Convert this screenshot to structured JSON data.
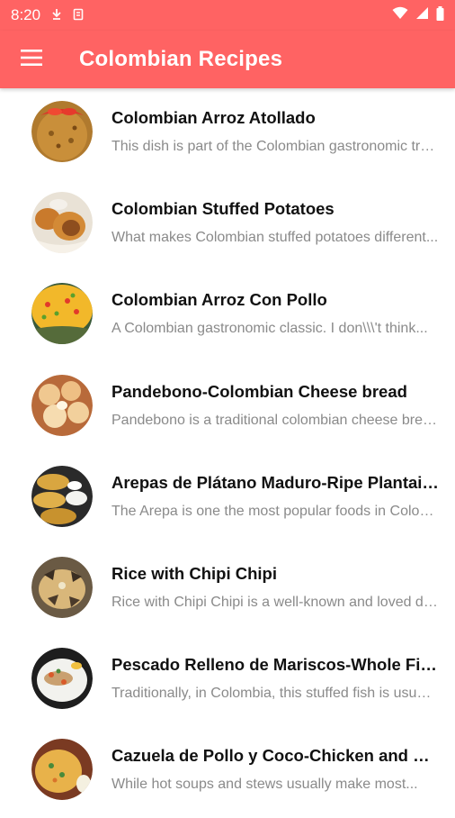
{
  "status_bar": {
    "time": "8:20",
    "icons": [
      "download-status-icon",
      "storage-status-icon",
      "wifi-icon",
      "signal-icon",
      "battery-icon"
    ]
  },
  "app_bar": {
    "title": "Colombian Recipes",
    "background": "#ff6363",
    "menu_icon": "hamburger-menu-icon"
  },
  "recipes": [
    {
      "title": "Colombian Arroz Atollado",
      "description": "This dish is part of the Colombian gastronomic traditions...",
      "thumbnail": "rice-dish-thumbnail"
    },
    {
      "title": "Colombian Stuffed Potatoes",
      "description": "What makes Colombian stuffed potatoes different...",
      "thumbnail": "stuffed-potatoes-thumbnail"
    },
    {
      "title": "Colombian Arroz Con Pollo",
      "description": "A Colombian gastronomic classic. I don\\\\\\'t think...",
      "thumbnail": "chicken-rice-thumbnail"
    },
    {
      "title": "Pandebono-Colombian Cheese bread",
      "description": "Pandebono is a traditional colombian cheese bread...",
      "thumbnail": "cheese-bread-thumbnail"
    },
    {
      "title": "Arepas de Plátano Maduro-Ripe Plantain Arepas",
      "description": "The Arepa is one the most popular foods in Colombia...",
      "thumbnail": "arepas-thumbnail"
    },
    {
      "title": "Rice with Chipi Chipi",
      "description": "Rice with Chipi Chipi is a well-known and loved dish...",
      "thumbnail": "chipi-chipi-thumbnail"
    },
    {
      "title": "Pescado Relleno de Mariscos-Whole Fish Stuffed",
      "description": "Traditionally, in Colombia, this stuffed fish is usually...",
      "thumbnail": "stuffed-fish-thumbnail"
    },
    {
      "title": "Cazuela de Pollo y Coco-Chicken and Coconut Stew",
      "description": "While hot soups and stews usually make most...",
      "thumbnail": "chicken-stew-thumbnail"
    }
  ]
}
